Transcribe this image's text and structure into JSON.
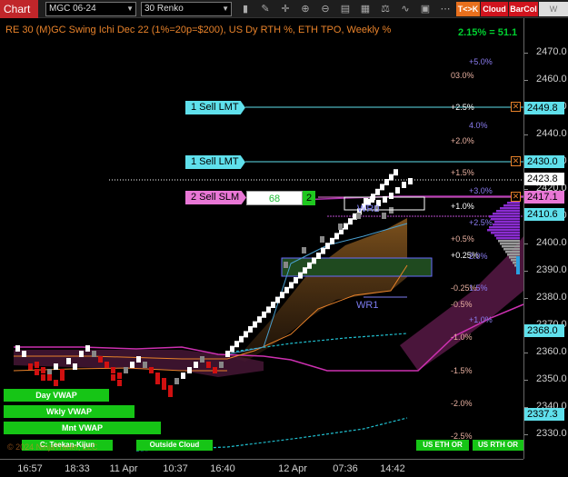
{
  "toolbar": {
    "tab_label": "Chart",
    "instrument": "MGC 06-24",
    "bar_type": "30 Renko",
    "icons": [
      "bar-style-icon",
      "drawing-tools-icon",
      "crosshair-icon",
      "zoom-in-icon",
      "zoom-out-icon",
      "properties-icon",
      "templates-icon",
      "strategy-icon",
      "indicators-icon",
      "data-box-icon",
      "more-icon"
    ],
    "tk_label": "T<>K",
    "cloud_label": "Cloud",
    "barcol_label": "BarCol",
    "vwap_label": "W VWAP"
  },
  "chart": {
    "title": "RE 30 (M)GC Swing Ichi Dec 22 (1%=20p=$200), US Dy RTH %, ETH TPO, Weekly %",
    "ratio": "2.15% = 51.1",
    "wr0_label": "WR0",
    "wr1_label": "WR1",
    "footer": "© 2024 NinjaTrader, LLC"
  },
  "price_axis": {
    "ticks": [
      "2470.0",
      "2460.0",
      "2450.0",
      "2440.0",
      "2430.0",
      "2420.0",
      "2410.0",
      "2400.0",
      "2390.0",
      "2380.0",
      "2370.0",
      "2360.0",
      "2350.0",
      "2340.0",
      "2330.0"
    ],
    "tags": [
      {
        "value": "2449.8",
        "color": "#5fe0ec"
      },
      {
        "value": "2430.0",
        "color": "#5fe0ec"
      },
      {
        "value": "2423.8",
        "color": "#ffffff"
      },
      {
        "value": "2417.1",
        "color": "#e977d6"
      },
      {
        "value": "2410.6",
        "color": "#5fe0ec"
      },
      {
        "value": "2368.0",
        "color": "#5fe0ec"
      },
      {
        "value": "2337.3",
        "color": "#5fe0ec"
      }
    ]
  },
  "time_axis": [
    "16:57",
    "18:33",
    "11 Apr",
    "10:37",
    "16:40",
    "12 Apr",
    "07:36",
    "14:42"
  ],
  "orders": [
    {
      "label": "1 Sell LMT"
    },
    {
      "label": "1 Sell LMT"
    },
    {
      "label": "2 Sell SLM",
      "qty": "68",
      "badge": "2"
    }
  ],
  "pct_labels": [
    {
      "text": "+5.0%",
      "color": "#8a7cf0"
    },
    {
      "text": "03.0%",
      "color": "#e8b0a0"
    },
    {
      "text": "+2.5%",
      "color": "#ffffff"
    },
    {
      "text": "4.0%",
      "color": "#8a7cf0"
    },
    {
      "text": "+2.0%",
      "color": "#e8b0a0"
    },
    {
      "text": "+1.5%",
      "color": "#e8b0a0"
    },
    {
      "text": "+3.0%",
      "color": "#8a7cf0"
    },
    {
      "text": "+1.0%",
      "color": "#ffffff"
    },
    {
      "text": "+2.5%",
      "color": "#8a7cf0"
    },
    {
      "text": "+0.5%",
      "color": "#e8b0a0"
    },
    {
      "text": "+0.25%",
      "color": "#ffffff"
    },
    {
      "text": "2.0%",
      "color": "#8a7cf0"
    },
    {
      "text": "-0.25%",
      "color": "#e8b0a0"
    },
    {
      "text": "1.5%",
      "color": "#8a7cf0"
    },
    {
      "text": "-0.5%",
      "color": "#e8b0a0"
    },
    {
      "text": "+1.0%",
      "color": "#8a7cf0"
    },
    {
      "text": "-1.0%",
      "color": "#e8b0a0"
    },
    {
      "text": "-1.5%",
      "color": "#e8b0a0"
    },
    {
      "text": "-2.0%",
      "color": "#e8b0a0"
    },
    {
      "text": "-2.5%",
      "color": "#e8b0a0"
    }
  ],
  "vwap_buttons": [
    "Day VWAP",
    "Wkly VWAP",
    "Mnt VWAP"
  ],
  "ichimoku_label": "C: Teekan-Kijun",
  "cloud_label": "Outside Cloud",
  "session_buttons": [
    "US ETH OR",
    "US RTH OR"
  ]
}
